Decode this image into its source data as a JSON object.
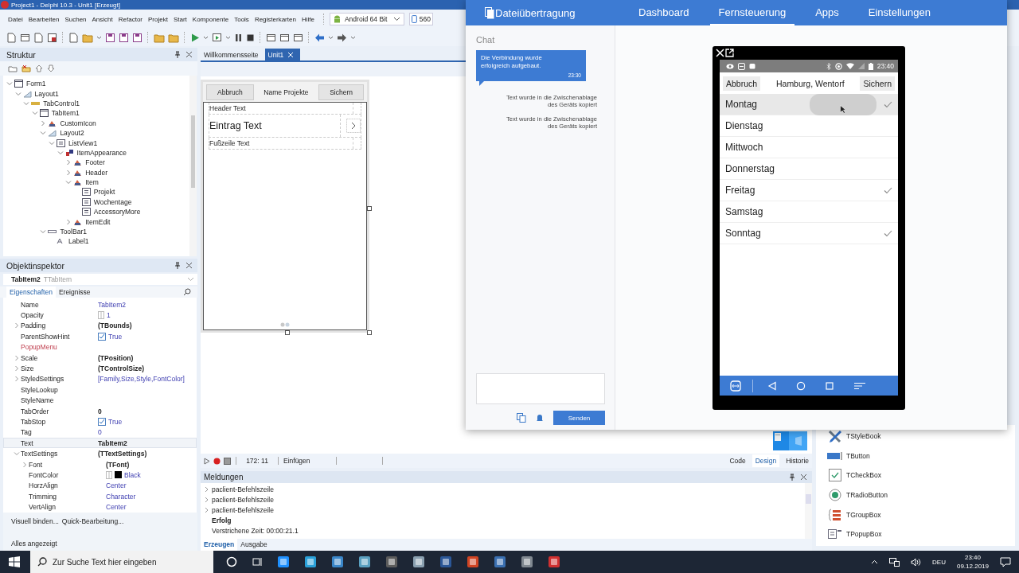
{
  "window": {
    "title": "Project1 - Delphi 10.3 - Unit1 [Erzeugt]"
  },
  "menu": [
    "Datei",
    "Bearbeiten",
    "Suchen",
    "Ansicht",
    "Refactor",
    "Projekt",
    "Start",
    "Komponente",
    "Tools",
    "Registerkarten",
    "Hilfe"
  ],
  "target": {
    "platform": "Android 64 Bit",
    "device": "560"
  },
  "structure": {
    "title": "Struktur",
    "tree": [
      {
        "label": "Form1",
        "kind": "form",
        "expanded": true,
        "children": [
          {
            "label": "Layout1",
            "kind": "layout",
            "expanded": true,
            "children": [
              {
                "label": "TabControl1",
                "kind": "tabcontrol",
                "expanded": true,
                "children": [
                  {
                    "label": "TabItem1",
                    "kind": "tabitem",
                    "expanded": true,
                    "children": [
                      {
                        "label": "CustomIcon",
                        "kind": "component",
                        "expanded": false
                      },
                      {
                        "label": "Layout2",
                        "kind": "layout",
                        "expanded": true,
                        "children": [
                          {
                            "label": "ListView1",
                            "kind": "listview",
                            "expanded": true,
                            "children": [
                              {
                                "label": "ItemAppearance",
                                "kind": "appearance",
                                "expanded": true,
                                "children": [
                                  {
                                    "label": "Footer",
                                    "kind": "component",
                                    "expanded": false
                                  },
                                  {
                                    "label": "Header",
                                    "kind": "component",
                                    "expanded": false
                                  },
                                  {
                                    "label": "Item",
                                    "kind": "component",
                                    "expanded": true,
                                    "children": [
                                      {
                                        "label": "Projekt",
                                        "kind": "object"
                                      },
                                      {
                                        "label": "Wochentage",
                                        "kind": "object"
                                      },
                                      {
                                        "label": "AccessoryMore",
                                        "kind": "object"
                                      }
                                    ]
                                  },
                                  {
                                    "label": "ItemEdit",
                                    "kind": "component",
                                    "expanded": false
                                  }
                                ]
                              }
                            ]
                          }
                        ]
                      },
                      {
                        "label": "ToolBar1",
                        "kind": "toolbar",
                        "expanded": true,
                        "children": [
                          {
                            "label": "Label1",
                            "kind": "label"
                          }
                        ]
                      }
                    ]
                  }
                ]
              }
            ]
          }
        ]
      }
    ]
  },
  "inspector": {
    "title": "Objektinspektor",
    "object": "TabItem2",
    "object_type": "TTabItem",
    "tabs": [
      {
        "label": "Eigenschaften",
        "selected": true
      },
      {
        "label": "Ereignisse",
        "selected": false
      }
    ],
    "properties": [
      {
        "name": "Name",
        "value": "TabItem2",
        "kind": "link",
        "selected": false
      },
      {
        "name": "Opacity",
        "value": "1",
        "kind": "number",
        "selected": false
      },
      {
        "name": "Padding",
        "value": "(TBounds)",
        "kind": "bold",
        "expanded": false,
        "selected": false
      },
      {
        "name": "ParentShowHint",
        "value": "True",
        "kind": "check",
        "checked": true,
        "selected": false
      },
      {
        "name": "PopupMenu",
        "kind": "reference",
        "selected": false
      },
      {
        "name": "Scale",
        "value": "(TPosition)",
        "kind": "bold",
        "expanded": false,
        "selected": false
      },
      {
        "name": "Size",
        "value": "(TControlSize)",
        "kind": "bold",
        "expanded": false,
        "selected": false
      },
      {
        "name": "StyledSettings",
        "value": "[Family,Size,Style,FontColor]",
        "kind": "link",
        "expanded": false,
        "selected": false
      },
      {
        "name": "StyleLookup",
        "kind": "plain",
        "selected": false
      },
      {
        "name": "StyleName",
        "kind": "plain",
        "selected": false
      },
      {
        "name": "TabOrder",
        "value": "0",
        "kind": "bold",
        "selected": false
      },
      {
        "name": "TabStop",
        "value": "True",
        "kind": "check",
        "checked": true,
        "selected": false
      },
      {
        "name": "Tag",
        "value": "0",
        "kind": "link",
        "selected": false
      },
      {
        "name": "Text",
        "value": "TabItem2",
        "kind": "bold",
        "selected": true
      },
      {
        "name": "TextSettings",
        "value": "(TTextSettings)",
        "kind": "bold",
        "expanded": true,
        "selected": false,
        "children": [
          {
            "name": "Font",
            "value": "(TFont)",
            "kind": "bold",
            "expanded": false,
            "selected": false
          },
          {
            "name": "FontColor",
            "value": "Black",
            "kind": "swatch",
            "color": "#000000",
            "selected": false
          },
          {
            "name": "HorzAlign",
            "value": "Center",
            "kind": "link",
            "selected": false
          },
          {
            "name": "Trimming",
            "value": "Character",
            "kind": "link",
            "selected": false
          },
          {
            "name": "VertAlign",
            "value": "Center",
            "kind": "link",
            "selected": false
          }
        ]
      }
    ],
    "links": [
      "Visuell binden...",
      "Quick-Bearbeitung..."
    ],
    "status": "Alles angezeigt"
  },
  "editor": {
    "tabs": [
      {
        "label": "Willkommensseite",
        "selected": false,
        "closable": false
      },
      {
        "label": "Unit1",
        "selected": true,
        "closable": true
      }
    ],
    "form": {
      "left_button": "Abbruch",
      "title": "Name Projekte",
      "right_button": "Sichern",
      "header": "Header Text",
      "item": "Eintrag Text",
      "footer": "Fußzeile Text"
    },
    "status": {
      "position": "172: 11",
      "mode": "Einfügen"
    },
    "view_tabs": [
      {
        "label": "Code",
        "selected": false
      },
      {
        "label": "Design",
        "selected": true
      },
      {
        "label": "Historie",
        "selected": false
      }
    ]
  },
  "messages": {
    "title": "Meldungen",
    "lines": [
      {
        "text": "paclient-Befehlszeile",
        "kind": "group"
      },
      {
        "text": "paclient-Befehlszeile",
        "kind": "group"
      },
      {
        "text": "paclient-Befehlszeile",
        "kind": "group"
      },
      {
        "text": "Erfolg",
        "kind": "bold"
      },
      {
        "text": "Verstrichene Zeit: 00:00:21.1",
        "kind": "plain"
      }
    ],
    "tabs": [
      {
        "label": "Erzeugen",
        "selected": true
      },
      {
        "label": "Ausgabe",
        "selected": false
      }
    ]
  },
  "palette": [
    {
      "label": "TStyleBook",
      "kind": "stylebook"
    },
    {
      "label": "TButton",
      "kind": "button"
    },
    {
      "label": "TCheckBox",
      "kind": "checkbox"
    },
    {
      "label": "TRadioButton",
      "kind": "radio"
    },
    {
      "label": "TGroupBox",
      "kind": "groupbox"
    },
    {
      "label": "TPopupBox",
      "kind": "popupbox"
    }
  ],
  "remote": {
    "title": "Dateiübertragung",
    "nav": [
      {
        "label": "Dashboard",
        "selected": false
      },
      {
        "label": "Fernsteuerung",
        "selected": true
      },
      {
        "label": "Apps",
        "selected": false
      },
      {
        "label": "Einstellungen",
        "selected": false
      }
    ],
    "chat": {
      "title": "Chat",
      "message": {
        "text": "Die Verbindung wurde erfolgreich aufgebaut.",
        "time": "23:30"
      },
      "notices": [
        "Text wurde in die Zwischenablage des Geräts kopiert",
        "Text wurde in die Zwischenablage des Geräts kopiert"
      ],
      "send": "Senden"
    },
    "phone": {
      "time": "23:40",
      "cancel": "Abbruch",
      "title": "Hamburg, Wentorf",
      "save": "Sichern",
      "days": [
        {
          "label": "Montag",
          "checked": true,
          "highlighted": true
        },
        {
          "label": "Dienstag",
          "checked": false,
          "highlighted": false
        },
        {
          "label": "Mittwoch",
          "checked": false,
          "highlighted": false
        },
        {
          "label": "Donnerstag",
          "checked": false,
          "highlighted": false
        },
        {
          "label": "Freitag",
          "checked": true,
          "highlighted": false
        },
        {
          "label": "Samstag",
          "checked": false,
          "highlighted": false
        },
        {
          "label": "Sonntag",
          "checked": true,
          "highlighted": false
        }
      ]
    }
  },
  "taskbar": {
    "search_placeholder": "Zur Suche Text hier eingeben",
    "language": "DEU",
    "time": "23:40",
    "date": "09.12.2019"
  }
}
